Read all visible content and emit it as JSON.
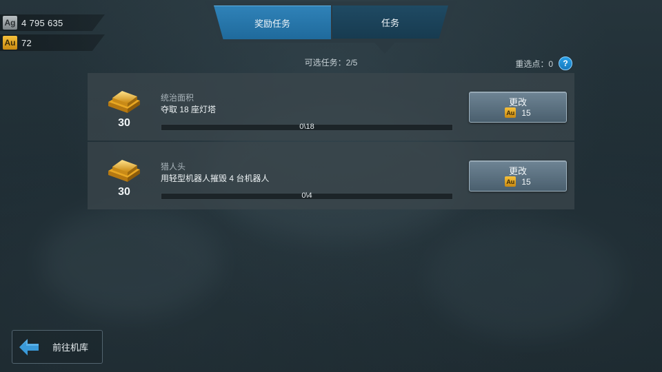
{
  "currency": {
    "silver": {
      "code": "Ag",
      "value": "4 795 635"
    },
    "gold": {
      "code": "Au",
      "value": "72"
    }
  },
  "tabs": [
    {
      "label": "奖励任务",
      "active": true
    },
    {
      "label": "任务",
      "active": false
    }
  ],
  "slots_text": "可选任务：2/5",
  "reroll_text": "重选点：0",
  "help_symbol": "?",
  "tasks": [
    {
      "reward": "30",
      "category": "统治面积",
      "description": "夺取 18 座灯塔",
      "progress_text": "0\\18",
      "progress": 0,
      "change_label": "更改",
      "cost_code": "Au",
      "cost": "15"
    },
    {
      "reward": "30",
      "category": "猎人头",
      "description": "用轻型机器人摧毁 4 台机器人",
      "progress_text": "0\\4",
      "progress": 0,
      "change_label": "更改",
      "cost_code": "Au",
      "cost": "15"
    }
  ],
  "bottom": {
    "hangar_label": "前往机库"
  },
  "colors": {
    "accent": "#2f82b8",
    "gold": "#f6c13b",
    "help": "#1579bd"
  }
}
